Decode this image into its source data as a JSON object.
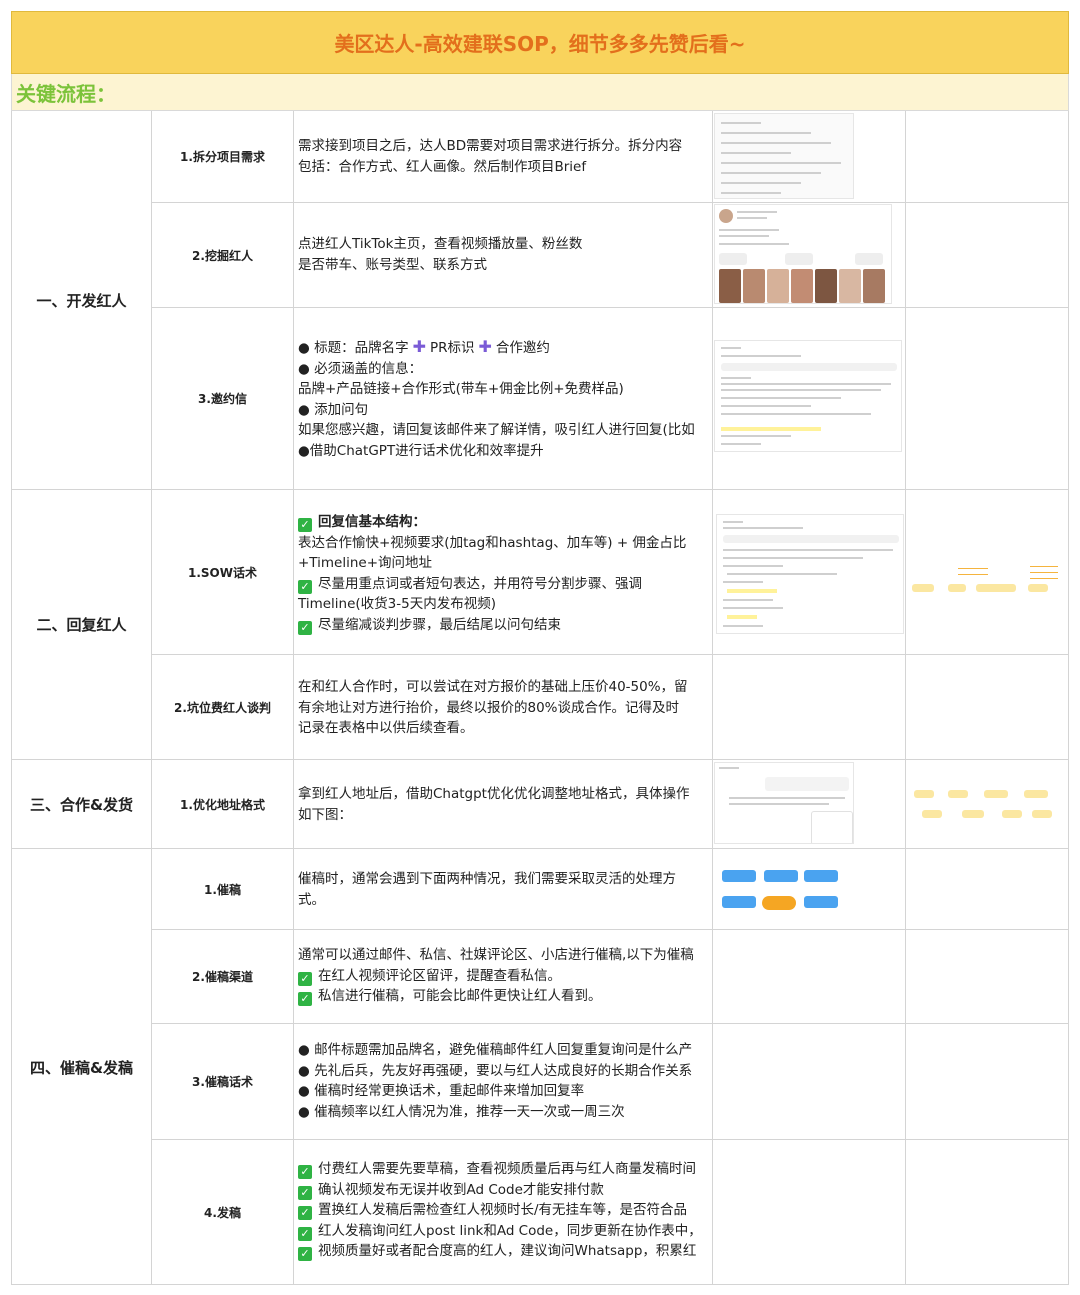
{
  "header": {
    "title": "美区达人-高效建联SOP，细节多多先赞后看~",
    "subtitle": "关键流程："
  },
  "sections": {
    "s1": "一、开发红人",
    "s2": "二、回复红人",
    "s3": "三、合作&发货",
    "s4": "四、催稿&发稿"
  },
  "steps": {
    "s1_1": "1.拆分项目需求",
    "s1_2": "2.挖掘红人",
    "s1_3": "3.邀约信",
    "s2_1": "1.SOW话术",
    "s2_2": "2.坑位费红人谈判",
    "s3_1": "1.优化地址格式",
    "s4_1": "1.催稿",
    "s4_2": "2.催稿渠道",
    "s4_3": "3.催稿话术",
    "s4_4": "4.发稿"
  },
  "content": {
    "s1_1": [
      "需求接到项目之后，达人BD需要对项目需求进行拆分。拆分内容",
      "包括：合作方式、红人画像。然后制作项目Brief"
    ],
    "s1_2": [
      "点进红人TikTok主页，查看视频播放量、粉丝数",
      "是否带车、账号类型、联系方式"
    ],
    "s1_3": {
      "line1_a": "● 标题：品牌名字",
      "line1_b": "PR标识",
      "line1_c": "合作邀约",
      "rest": [
        "● 必须涵盖的信息：",
        "品牌+产品链接+合作形式(带车+佣金比例+免费样品)",
        "● 添加问句",
        "如果您感兴趣，请回复该邮件来了解详情，吸引红人进行回复(比如",
        "●借助ChatGPT进行话术优化和效率提升"
      ]
    },
    "s2_1": {
      "heading": "回复信基本结构：",
      "l2": "表达合作愉快+视频要求(加tag和hashtag、加车等) + 佣金占比",
      "l3": "+Timeline+询问地址",
      "l4": "尽量用重点词或者短句表达，并用符号分割步骤、强调",
      "l5": "Timeline(收货3-5天内发布视频)",
      "l6": "尽量缩减谈判步骤，最后结尾以问句结束"
    },
    "s2_2": [
      "在和红人合作时，可以尝试在对方报价的基础上压价40-50%，留",
      "有余地让对方进行抬价，最终以报价的80%谈成合作。记得及时",
      "记录在表格中以供后续查看。"
    ],
    "s3_1": [
      "拿到红人地址后，借助Chatgpt优化优化调整地址格式，具体操作",
      "如下图："
    ],
    "s4_1": [
      "催稿时，通常会遇到下面两种情况，我们需要采取灵活的处理方",
      "式。"
    ],
    "s4_2": {
      "l1": "通常可以通过邮件、私信、社媒评论区、小店进行催稿,以下为催稿",
      "l2": "在红人视频评论区留评，提醒查看私信。",
      "l3": "私信进行催稿，可能会比邮件更快让红人看到。"
    },
    "s4_3": [
      "● 邮件标题需加品牌名，避免催稿邮件红人回复重复询问是什么产",
      "● 先礼后兵，先友好再强硬，要以与红人达成良好的长期合作关系",
      "● 催稿时经常更换话术，重起邮件来增加回复率",
      "● 催稿频率以红人情况为准，推荐一天一次或一周三次"
    ],
    "s4_4": [
      "付费红人需要先要草稿，查看视频质量后再与红人商量发稿时间",
      "确认视频发布无误并收到Ad Code才能安排付款",
      "置换红人发稿后需检查红人视频时长/有无挂车等，是否符合品",
      "红人发稿询问红人post link和Ad Code，同步更新在协作表中，",
      "视频质量好或者配合度高的红人，建议询问Whatsapp，积累红"
    ]
  },
  "check_glyph": "✓",
  "plus_glyph": "✚",
  "colors": {
    "title_bg": "#f9d35c",
    "title_text": "#e36f1c",
    "subtitle_bg": "#fdf4d2",
    "subtitle_text": "#7cc33a",
    "check_bg": "#2fb344",
    "plus": "#7a5bd6"
  }
}
